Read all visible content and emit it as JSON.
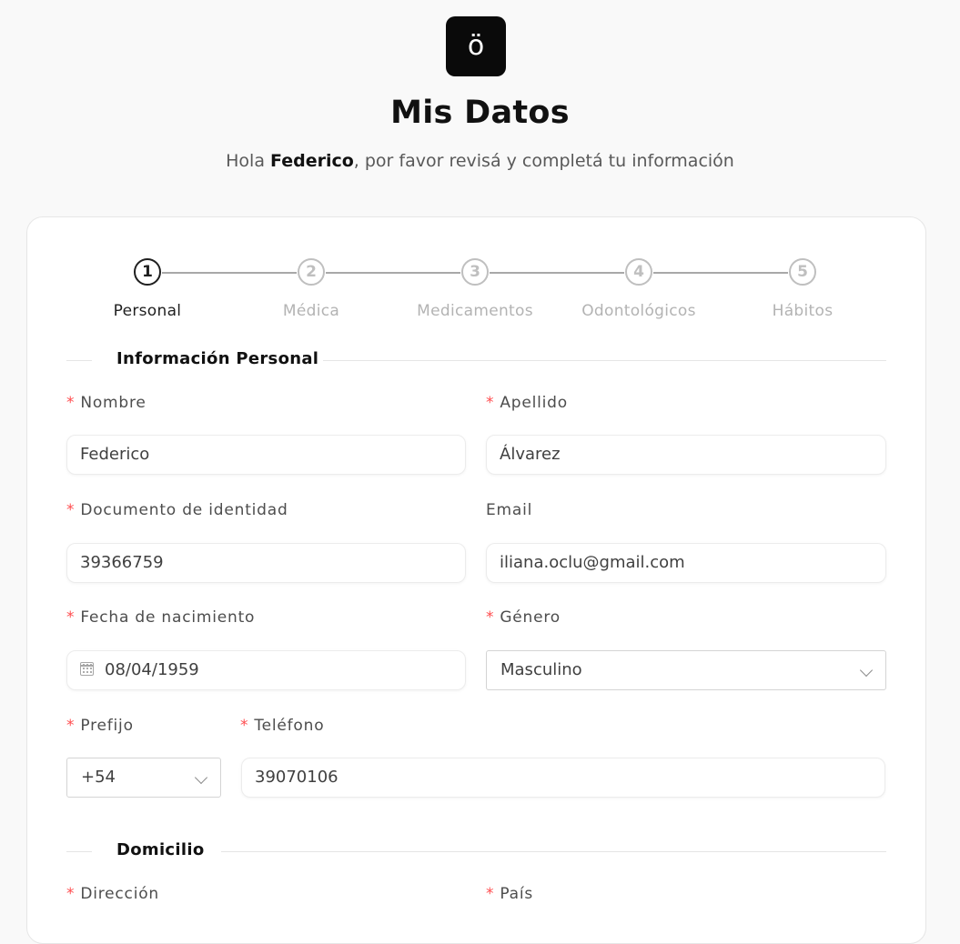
{
  "header": {
    "logo_glyph": "ö",
    "title": "Mis Datos",
    "greeting_prefix": "Hola ",
    "user_name": "Federico",
    "greeting_suffix": ", por favor revisá y completá tu información"
  },
  "steps": [
    {
      "number": "1",
      "label": "Personal",
      "active": true
    },
    {
      "number": "2",
      "label": "Médica",
      "active": false
    },
    {
      "number": "3",
      "label": "Medicamentos",
      "active": false
    },
    {
      "number": "4",
      "label": "Odontológicos",
      "active": false
    },
    {
      "number": "5",
      "label": "Hábitos",
      "active": false
    }
  ],
  "sections": {
    "personal": "Información Personal",
    "address": "Domicilio"
  },
  "required_mark": "*",
  "fields": {
    "nombre": {
      "label": "Nombre",
      "value": "Federico",
      "required": true
    },
    "apellido": {
      "label": "Apellido",
      "value": "Álvarez",
      "required": true
    },
    "documento": {
      "label": "Documento de identidad",
      "value": "39366759",
      "required": true
    },
    "email": {
      "label": "Email",
      "value": "iliana.oclu@gmail.com",
      "required": false
    },
    "fecha_nacimiento": {
      "label": "Fecha de nacimiento",
      "value": "08/04/1959",
      "required": true
    },
    "genero": {
      "label": "Género",
      "value": "Masculino",
      "required": true
    },
    "prefijo": {
      "label": "Prefijo",
      "value": "+54",
      "required": true
    },
    "telefono": {
      "label": "Teléfono",
      "value": "39070106",
      "required": true
    },
    "direccion": {
      "label": "Dirección",
      "required": true
    },
    "pais": {
      "label": "País",
      "required": true
    }
  },
  "colors": {
    "accent": "#0a0a0a",
    "required": "#ff4d4f",
    "inactive_step": "#bfbfbf"
  },
  "icons": {
    "calendar": "calendar-icon",
    "dropdown": "chevron-down-icon"
  }
}
